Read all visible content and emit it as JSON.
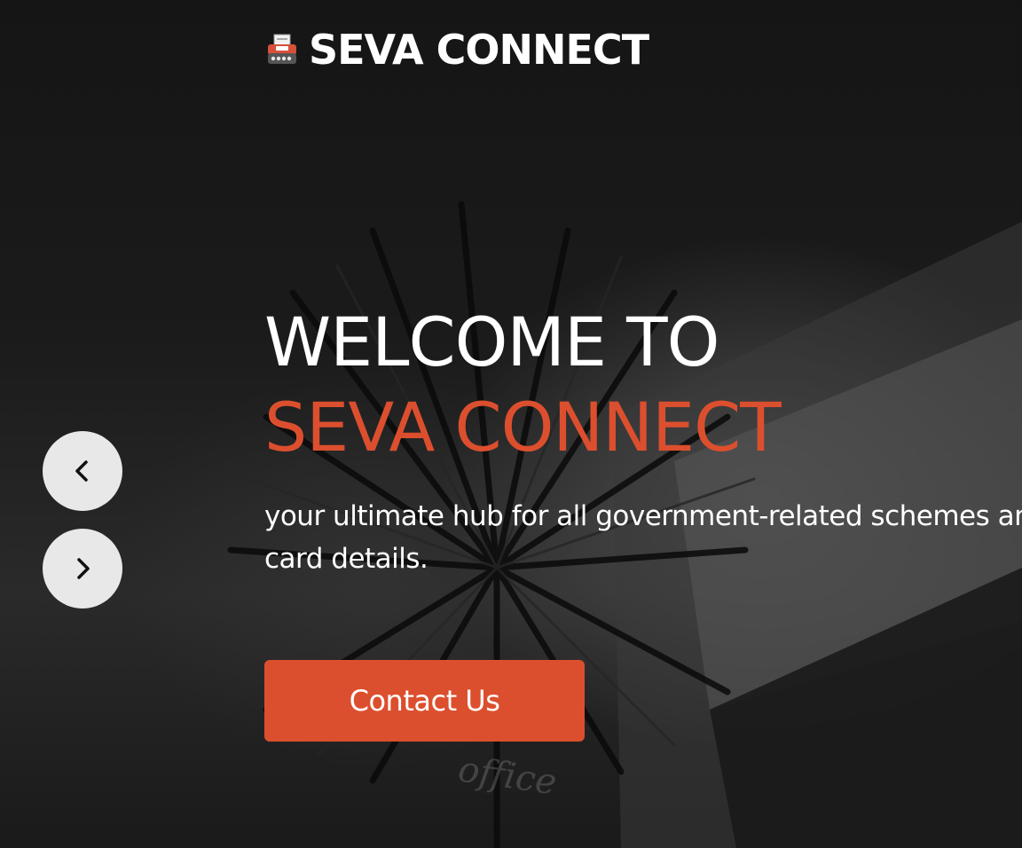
{
  "brand": {
    "name": "SEVA CONNECT",
    "icon": "typewriter-icon"
  },
  "hero": {
    "heading_line1": "WELCOME TO",
    "heading_line2": "SEVA CONNECT",
    "tagline": "your ultimate hub for all government-related schemes and card details.",
    "cta_label": "Contact Us",
    "accent_color": "#dc4f2e",
    "background_image_text": "office"
  },
  "carousel": {
    "prev_icon": "chevron-left-icon",
    "next_icon": "chevron-right-icon"
  }
}
